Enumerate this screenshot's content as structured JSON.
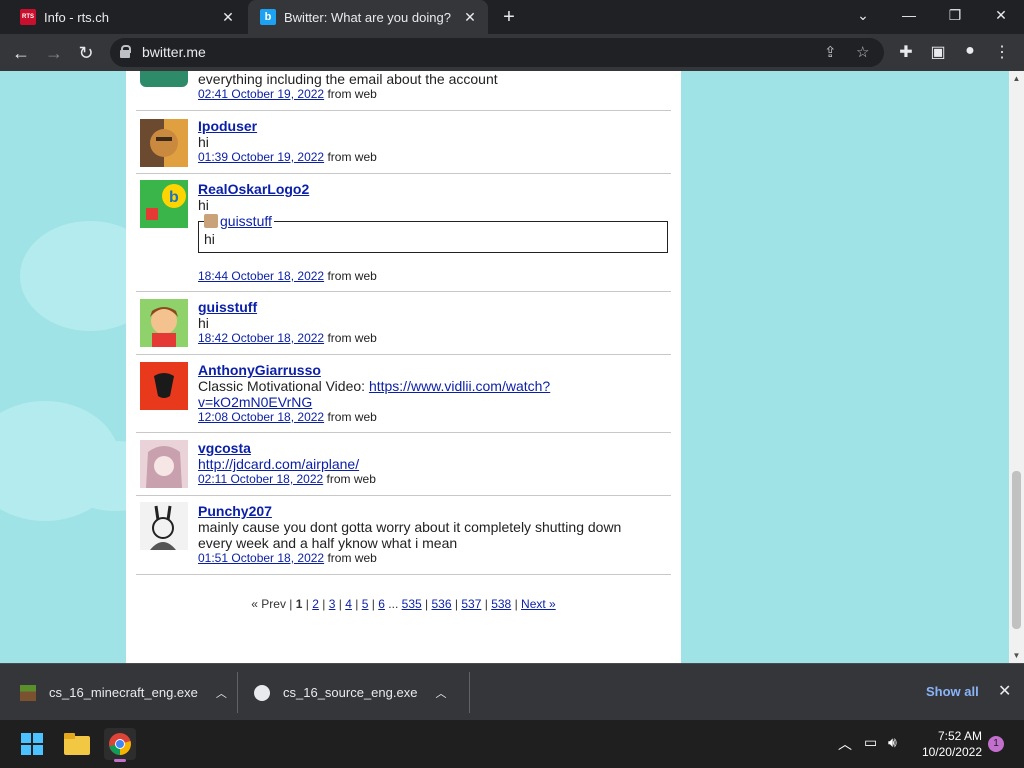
{
  "browser": {
    "tabs": [
      {
        "title": "Info - rts.ch",
        "favicon": "rts-icon",
        "active": false
      },
      {
        "title": "Bwitter: What are you doing?",
        "favicon": "bwitter-icon",
        "active": true
      }
    ],
    "url": "bwitter.me"
  },
  "timeline": {
    "statuses": [
      {
        "user": "",
        "text": "everything including the email about the account",
        "time": "02:41 October 19, 2022",
        "source": "from web"
      },
      {
        "user": "Ipoduser",
        "text": "hi",
        "time": "01:39 October 19, 2022",
        "source": "from web"
      },
      {
        "user": "RealOskarLogo2",
        "text": "hi",
        "quote_user": "guisstuff",
        "quote_text": "hi",
        "time": "18:44 October 18, 2022",
        "source": "from web"
      },
      {
        "user": "guisstuff",
        "text": "hi",
        "time": "18:42 October 18, 2022",
        "source": "from web"
      },
      {
        "user": "AnthonyGiarrusso",
        "text": "Classic Motivational Video:",
        "link_1": "https://www.vidlii.com/watch?",
        "link_2": "v=kO2mN0EVrNG",
        "time": "12:08 October 18, 2022",
        "source": "from web"
      },
      {
        "user": "vgcosta",
        "link": "http://jdcard.com/airplane/",
        "time": "02:11 October 18, 2022",
        "source": "from web"
      },
      {
        "user": "Punchy207",
        "text_1": "mainly cause you dont gotta worry about it completely shutting down",
        "text_2": "every week and a half yknow what i mean",
        "time": "01:51 October 18, 2022",
        "source": "from web"
      }
    ]
  },
  "pager": {
    "prev": "« Prev",
    "current": "1",
    "pages": [
      "2",
      "3",
      "4",
      "5",
      "6"
    ],
    "ellipsis": "...",
    "last_pages": [
      "535",
      "536",
      "537",
      "538"
    ],
    "next": "Next »",
    "sep": "|"
  },
  "downloads": {
    "items": [
      {
        "name": "cs_16_minecraft_eng.exe",
        "icon": "minecraft-icon"
      },
      {
        "name": "cs_16_source_eng.exe",
        "icon": "cs-icon"
      }
    ],
    "show_all": "Show all"
  },
  "taskbar": {
    "time": "7:52 AM",
    "date": "10/20/2022",
    "notifications": "1"
  },
  "colors": {
    "page_bg": "#9fe3e6",
    "link": "#0a1fa8",
    "chrome_dark": "#202124",
    "chrome_toolbar": "#35363a"
  }
}
